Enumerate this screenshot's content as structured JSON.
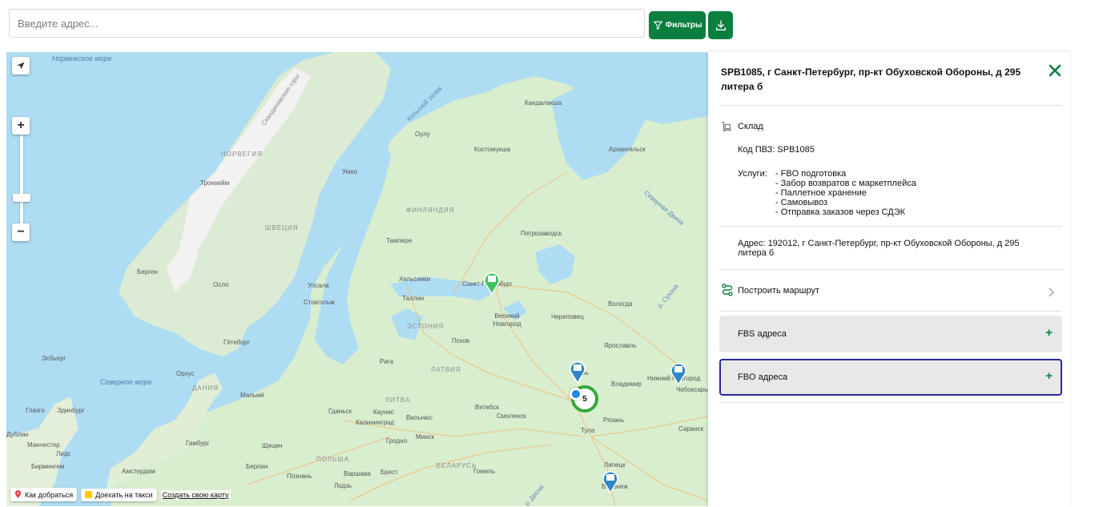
{
  "search": {
    "placeholder": "Введите адрес...",
    "value": ""
  },
  "toolbar": {
    "filters_label": "Фильтры",
    "filter_icon": "filter-icon",
    "download_icon": "download-icon"
  },
  "map": {
    "sea_labels": [
      "Норвежское море",
      "Северное море"
    ],
    "country_labels": [
      "НОРВЕГИЯ",
      "ШВЕЦИЯ",
      "ФИНЛЯНДИЯ",
      "ЭСТОНИЯ",
      "ЛАТВИЯ",
      "ЛИТВА",
      "БЕЛАРУСЬ",
      "ПОЛЬША",
      "ДАНИЯ"
    ],
    "region_labels": [
      "Скандинавские горы",
      "Кольский залив",
      "Северная Двина",
      "р. Сухона",
      "р. Десна"
    ],
    "cities": [
      "Тронхейм",
      "Умео",
      "Берген",
      "Осло",
      "Упсала",
      "Стокгольм",
      "Гётеборг",
      "Орхус",
      "Мальмё",
      "Эсбьерг",
      "Гданьск",
      "Калининград",
      "Каунас",
      "Вильнюс",
      "Рига",
      "Таллин",
      "Хельсинки",
      "Тампере",
      "Оулу",
      "Костомукша",
      "Кандалакша",
      "Петрозаводск",
      "Архангельск",
      "Санкт-Петербург",
      "Великий Новгород",
      "Псков",
      "Череповец",
      "Вологда",
      "Ярославль",
      "Тверь",
      "Владимир",
      "Нижний Новгород",
      "Чебоксары",
      "Витебск",
      "Смоленск",
      "Минск",
      "Гродно",
      "Рязань",
      "Тула",
      "Саранск",
      "Брест",
      "Гомель",
      "Липецк",
      "Воронеж",
      "Гамбург",
      "Щецин",
      "Берлин",
      "Варшава",
      "Познань",
      "Лодзь",
      "Амстердам",
      "Бирмингем",
      "Манчестер",
      "Эдинбург",
      "Лидс",
      "Дублин",
      "Глазго"
    ],
    "cluster_count": "5",
    "attribution": {
      "directions": "Как добраться",
      "taxi": "Доехать на такси",
      "create_map": "Создать свою карту"
    }
  },
  "panel": {
    "title": "SPB1085, г Санкт-Петербург, пр-кт Обуховской Обороны, д 295 литера б",
    "type_label": "Склад",
    "code_label": "Код ПВЗ:",
    "code_value": "SPB1085",
    "services_label": "Услуги:",
    "services": [
      "- FBO подготовка",
      "- Забор возвратов с маркетплейса",
      "- Паллетное хранение",
      "- Самовывоз",
      "- Отправка заказов через СДЭК"
    ],
    "address_label": "Адрес:",
    "address_value": "192012, г Санкт-Петербург, пр-кт Обуховской Обороны, д 295 литера б",
    "route_label": "Построить маршрут",
    "fbs_label": "FBS адреса",
    "fbo_label": "FBO адреса",
    "accent": "#0a7f3f",
    "selected_border": "#26299a"
  }
}
